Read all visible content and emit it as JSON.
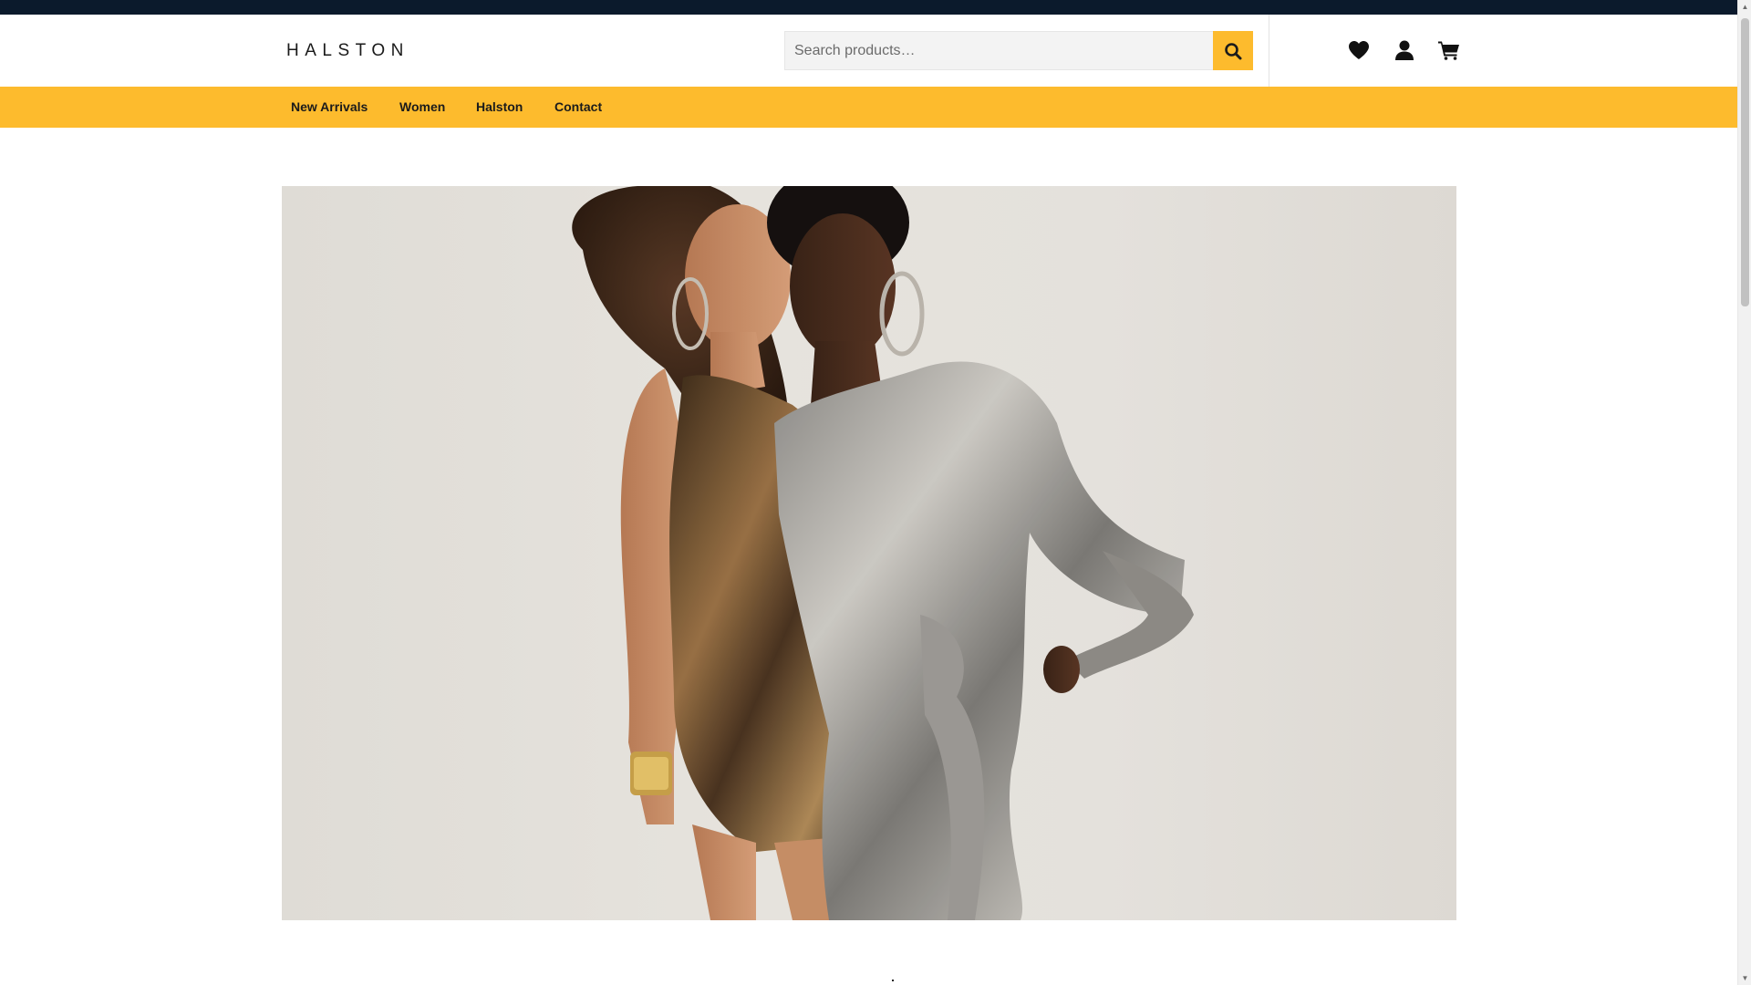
{
  "brand": {
    "logo_text": "HALSTON"
  },
  "search": {
    "placeholder": "Search products…",
    "value": ""
  },
  "header_icons": [
    {
      "name": "heart-icon",
      "label": "Wishlist"
    },
    {
      "name": "user-icon",
      "label": "Account"
    },
    {
      "name": "cart-icon",
      "label": "Cart"
    }
  ],
  "nav": {
    "items": [
      {
        "label": "New Arrivals"
      },
      {
        "label": "Women"
      },
      {
        "label": "Halston"
      },
      {
        "label": "Contact"
      }
    ]
  },
  "colors": {
    "topbar": "#0b1a2c",
    "accent": "#fdbb2d",
    "text": "#1b1b1b"
  }
}
